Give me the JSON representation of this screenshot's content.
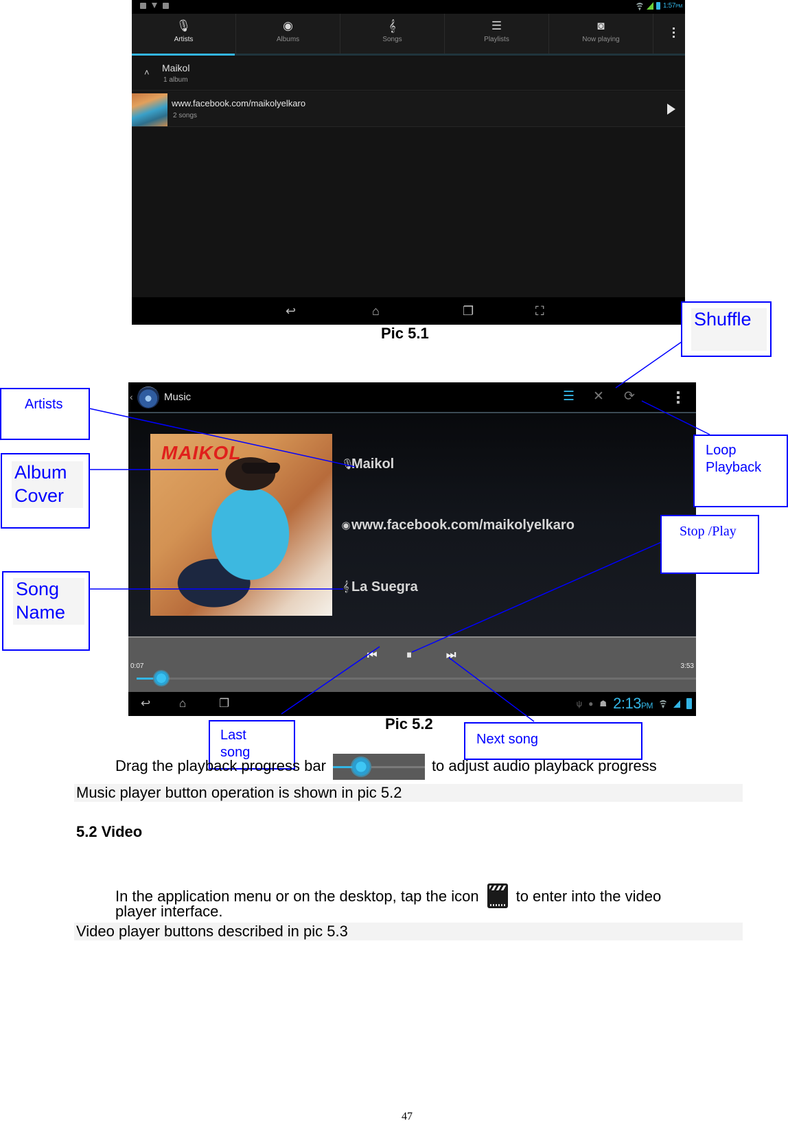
{
  "pic51": {
    "caption": "Pic 5.1",
    "status_time": "1:57",
    "status_ampm": "PM",
    "tabs": [
      {
        "label": "Artists",
        "icon": "microphone-icon",
        "glyph": "🎙",
        "active": true
      },
      {
        "label": "Albums",
        "icon": "album-disc-icon",
        "glyph": "◉",
        "active": false
      },
      {
        "label": "Songs",
        "icon": "treble-clef-icon",
        "glyph": "𝄞",
        "active": false
      },
      {
        "label": "Playlists",
        "icon": "playlist-icon",
        "glyph": "☰",
        "active": false
      },
      {
        "label": "Now playing",
        "icon": "now-playing-icon",
        "glyph": "◙",
        "active": false
      }
    ],
    "artist": {
      "name": "Maikol",
      "sub": "1 album",
      "chevron": "˄"
    },
    "album": {
      "title": "www.facebook.com/maikolyelkaro",
      "sub": "2 songs"
    },
    "nav": {
      "back": "↩",
      "home": "⌂",
      "recents": "❐",
      "screenshot": "⛶"
    }
  },
  "pic52": {
    "caption": "Pic 5.2",
    "app_title": "Music",
    "back_glyph": "‹",
    "actions": {
      "list": "☰",
      "shuffle": "✕",
      "repeat": "⟳"
    },
    "artist": "Maikol",
    "album": "www.facebook.com/maikolyelkaro",
    "song": "La Suegra",
    "cover_brand": "MAIKOL",
    "meta_icons": {
      "artist": "🎙",
      "album": "◉",
      "song": "𝄞"
    },
    "controls": {
      "prev": "⏮",
      "pause": "⏸",
      "next": "⏭"
    },
    "elapsed": "0:07",
    "duration": "3:53",
    "progress_fraction": 0.03,
    "clock": "2:13",
    "clock_ampm": "PM",
    "nav": {
      "back": "↩",
      "home": "⌂",
      "recents": "❐"
    },
    "sys_icons": {
      "usb": "ψ",
      "dot": "●",
      "android": "☗",
      "wifi": "◥"
    }
  },
  "annotations": {
    "artists": "Artists",
    "album_cover": [
      "Album",
      "Cover"
    ],
    "song_name": [
      "Song",
      "Name"
    ],
    "shuffle": "Shuffle",
    "loop": [
      "Loop",
      "Playback"
    ],
    "stop_play": "Stop /Play",
    "last_song": [
      "Last",
      "song"
    ],
    "next_song": "Next song"
  },
  "text": {
    "drag_before": "Drag the playback progress bar",
    "drag_after": "to adjust audio playback progress",
    "music_note": "Music player button operation is shown in pic 5.2",
    "video_heading": "5.2 Video",
    "video_line1_before": "In the application menu or on the desktop, tap the icon",
    "video_line1_after": "to enter into the video",
    "video_line2": "player interface.",
    "video_note": "Video player buttons described in pic 5.3",
    "page_number": "47"
  }
}
